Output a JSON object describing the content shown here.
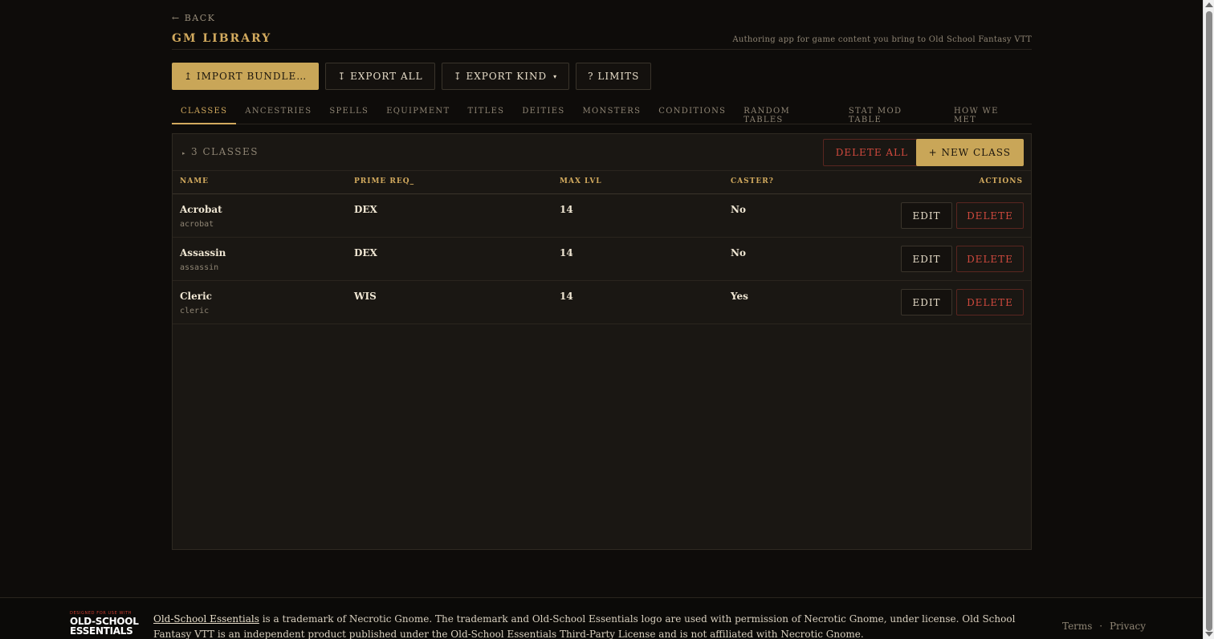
{
  "header": {
    "back_label": "← BACK",
    "title": "GM LIBRARY",
    "tagline": "Authoring app for game content you bring to Old School Fantasy VTT"
  },
  "toolbar": {
    "import_label": "↥ IMPORT BUNDLE…",
    "export_all_label": "↧ EXPORT ALL",
    "export_kind_label": "↧ EXPORT KIND",
    "export_kind_caret": "▾",
    "limits_label": "? LIMITS"
  },
  "tabs": [
    {
      "label": "CLASSES",
      "active": true
    },
    {
      "label": "ANCESTRIES"
    },
    {
      "label": "SPELLS"
    },
    {
      "label": "EQUIPMENT"
    },
    {
      "label": "TITLES"
    },
    {
      "label": "DEITIES"
    },
    {
      "label": "MONSTERS"
    },
    {
      "label": "CONDITIONS"
    },
    {
      "label": "RANDOM TABLES"
    },
    {
      "label": "STAT MOD TABLE"
    },
    {
      "label": "HOW WE MET"
    }
  ],
  "panel": {
    "count_marker": "▸",
    "count_label": "3 CLASSES",
    "delete_all_label": "DELETE ALL",
    "new_label": "+ NEW CLASS"
  },
  "table": {
    "columns": [
      "NAME",
      "PRIME REQ_",
      "MAX LVL",
      "CASTER?",
      "ACTIONS"
    ],
    "rows": [
      {
        "name": "Acrobat",
        "slug": "acrobat",
        "prime": "DEX",
        "max_lvl": "14",
        "caster": "No"
      },
      {
        "name": "Assassin",
        "slug": "assassin",
        "prime": "DEX",
        "max_lvl": "14",
        "caster": "No"
      },
      {
        "name": "Cleric",
        "slug": "cleric",
        "prime": "WIS",
        "max_lvl": "14",
        "caster": "Yes"
      }
    ],
    "edit_label": "EDIT",
    "delete_label": "DELETE"
  },
  "footer": {
    "logo_top": "DESIGNED FOR USE WITH",
    "logo_line1": "OLD-SCHOOL",
    "logo_line2": "ESSENTIALS",
    "link_text": "Old-School Essentials",
    "legal_text": " is a trademark of Necrotic Gnome. The trademark and Old-School Essentials logo are used with permission of Necrotic Gnome, under license. Old School Fantasy VTT is an independent product published under the Old-School Essentials Third-Party License and is not affiliated with Necrotic Gnome.",
    "terms_label": "Terms",
    "separator": "·",
    "privacy_label": "Privacy"
  },
  "colors": {
    "background": "#0e0c0a",
    "gold": "#c9a658",
    "danger": "#d14a3e",
    "panel": "#1a1713"
  }
}
